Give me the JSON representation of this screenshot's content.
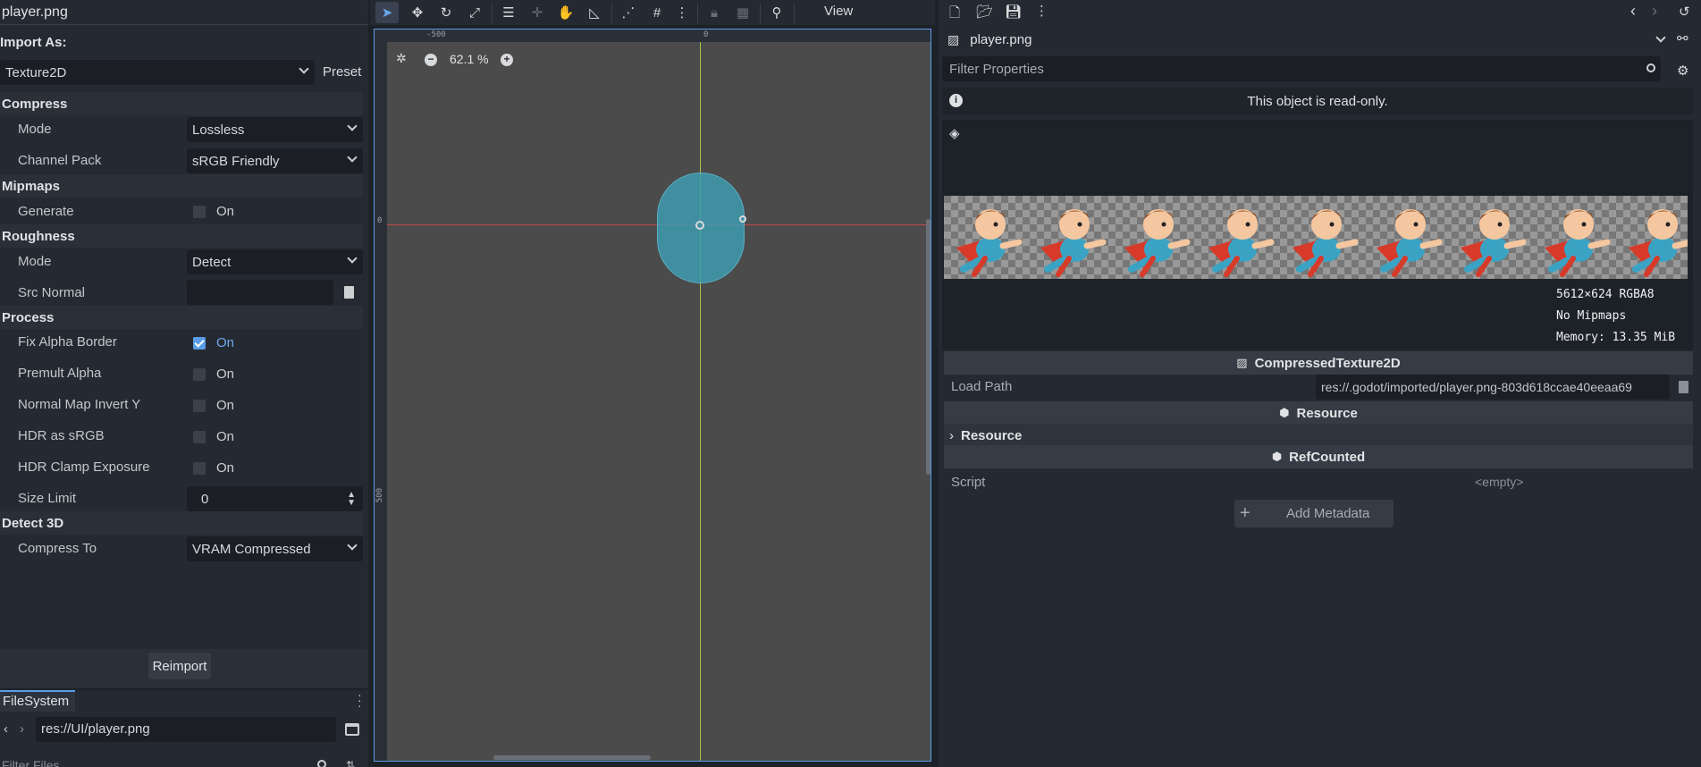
{
  "import_panel": {
    "file_name": "player.png",
    "import_as_label": "Import As:",
    "import_type": "Texture2D",
    "preset_label": "Preset",
    "sections": {
      "compress": "Compress",
      "mipmaps": "Mipmaps",
      "roughness": "Roughness",
      "process": "Process",
      "detect3d": "Detect 3D"
    },
    "props": {
      "compress_mode_label": "Mode",
      "compress_mode_value": "Lossless",
      "channel_pack_label": "Channel Pack",
      "channel_pack_value": "sRGB Friendly",
      "generate_label": "Generate",
      "roughness_mode_label": "Mode",
      "roughness_mode_value": "Detect",
      "src_normal_label": "Src Normal",
      "fix_alpha_label": "Fix Alpha Border",
      "premult_label": "Premult Alpha",
      "normal_map_label": "Normal Map Invert Y",
      "hdr_srgb_label": "HDR as sRGB",
      "hdr_clamp_label": "HDR Clamp Exposure",
      "size_limit_label": "Size Limit",
      "size_limit_value": "0",
      "compress_to_label": "Compress To",
      "compress_to_value": "VRAM Compressed",
      "on_text": "On"
    },
    "reimport_label": "Reimport"
  },
  "filesystem": {
    "tab_label": "FileSystem",
    "path": "res://UI/player.png",
    "filter_placeholder": "Filter Files"
  },
  "viewport": {
    "view_menu": "View",
    "zoom_label": "62.1 %",
    "ruler_marks": {
      "h_neg500": "-500",
      "h_zero": "0",
      "v_zero": "0",
      "v_500": "500"
    },
    "shape_color": "#3f9bb0"
  },
  "inspector": {
    "resource_name": "player.png",
    "filter_placeholder": "Filter Properties",
    "read_only_msg": "This object is read-only.",
    "texture_info": {
      "size": "5612×624 RGBA8",
      "mipmaps": "No Mipmaps",
      "memory": "Memory: 13.35 MiB"
    },
    "compressed_header": "CompressedTexture2D",
    "load_path_label": "Load Path",
    "load_path_value": "res://.godot/imported/player.png-803d618ccae40eeaa69",
    "resource_header": "Resource",
    "resource_section": "Resource",
    "refcounted_header": "RefCounted",
    "script_label": "Script",
    "script_value": "<empty>",
    "add_metadata_label": "Add Metadata"
  }
}
